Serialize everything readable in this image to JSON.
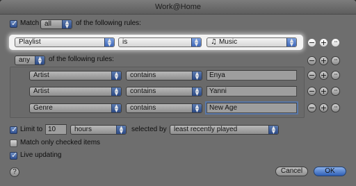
{
  "window": {
    "title": "Work@Home"
  },
  "header": {
    "match_checked": true,
    "match_label": "Match",
    "match_value": "all",
    "following_label": "of the following rules:"
  },
  "top_rule": {
    "field": "Playlist",
    "operator": "is",
    "value": "Music",
    "value_icon": "music-note-icon"
  },
  "subgroup": {
    "match_value": "any",
    "following_label": "of the following rules:",
    "rules": [
      {
        "field": "Artist",
        "operator": "contains",
        "value": "Enya"
      },
      {
        "field": "Artist",
        "operator": "contains",
        "value": "Yanni"
      },
      {
        "field": "Genre",
        "operator": "contains",
        "value": "New Age"
      }
    ]
  },
  "rule_buttons": {
    "remove": "−",
    "add": "+",
    "more": "···"
  },
  "limit": {
    "checked": true,
    "label": "Limit to",
    "amount": "10",
    "unit": "hours",
    "selected_by_label": "selected by",
    "selected_by": "least recently played"
  },
  "options": {
    "match_checked_label": "Match only checked items",
    "match_checked": false,
    "live_updating_label": "Live updating",
    "live_updating": true
  },
  "footer": {
    "help": "?",
    "cancel": "Cancel",
    "ok": "OK"
  },
  "colors": {
    "accent": "#3f68b8",
    "window": "#6e6e6e",
    "highlight": "#f3f3f3"
  }
}
